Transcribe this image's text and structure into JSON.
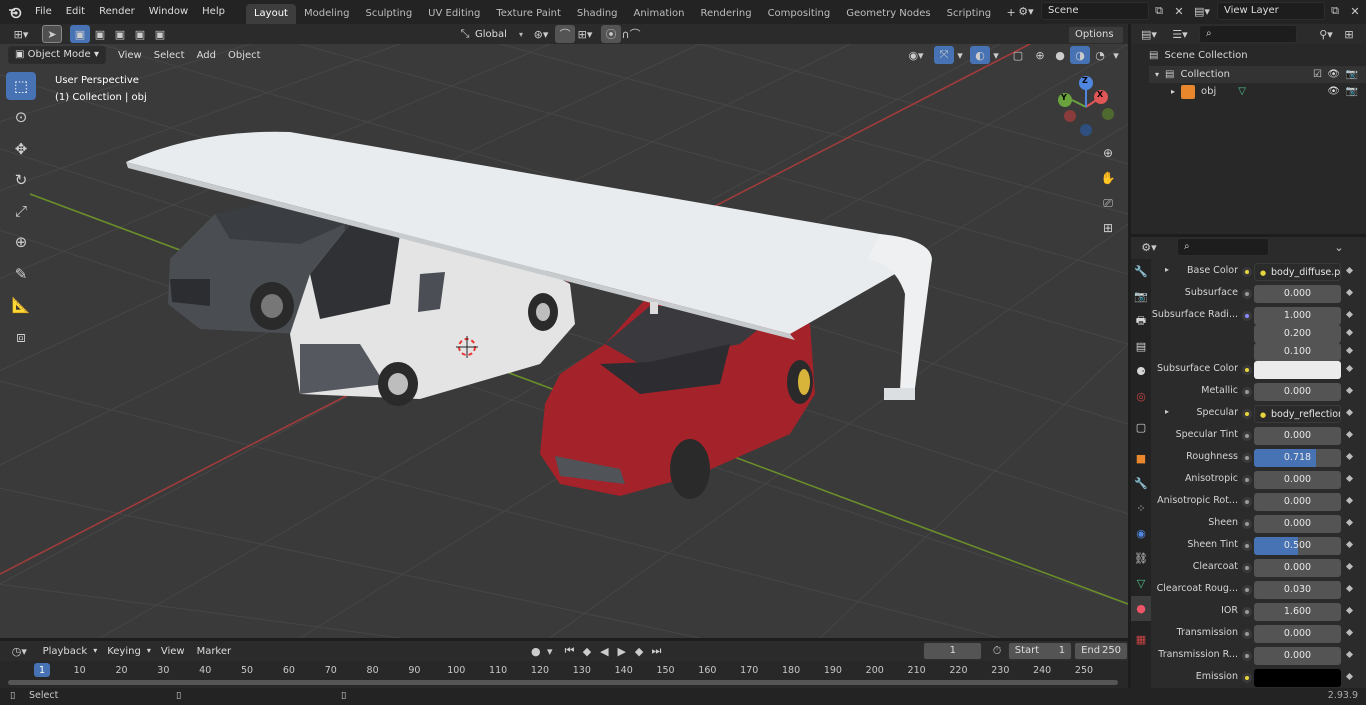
{
  "topbar": {
    "menus": [
      "File",
      "Edit",
      "Render",
      "Window",
      "Help"
    ],
    "workspaces": [
      "Layout",
      "Modeling",
      "Sculpting",
      "UV Editing",
      "Texture Paint",
      "Shading",
      "Animation",
      "Rendering",
      "Compositing",
      "Geometry Nodes",
      "Scripting"
    ],
    "active_workspace": "Layout",
    "scene": "Scene",
    "view_layer": "View Layer"
  },
  "viewport_header": {
    "mode": "Object Mode",
    "menus": [
      "View",
      "Select",
      "Add",
      "Object"
    ],
    "transform_orientation": "Global",
    "options": "Options"
  },
  "viewport": {
    "perspective": "User Perspective",
    "collection_info": "(1) Collection | obj",
    "axes": {
      "x": "X",
      "y": "Y",
      "z": "Z"
    }
  },
  "outliner": {
    "root": "Scene Collection",
    "collection": "Collection",
    "object": "obj"
  },
  "properties": {
    "rows": [
      {
        "label": "Base Color",
        "value": "body_diffuse.png",
        "kind": "texture",
        "expand": true
      },
      {
        "label": "Subsurface",
        "value": "0.000",
        "kind": "num"
      },
      {
        "label": "Subsurface Radi...",
        "value": "1.000",
        "kind": "num",
        "dot": "b"
      },
      {
        "label": "",
        "value": "0.200",
        "kind": "num",
        "nodot": true
      },
      {
        "label": "",
        "value": "0.100",
        "kind": "num",
        "nodot": true
      },
      {
        "label": "Subsurface Color",
        "value": "",
        "kind": "color",
        "color": "#ececec"
      },
      {
        "label": "Metallic",
        "value": "0.000",
        "kind": "num"
      },
      {
        "label": "Specular",
        "value": "body_reflection.png",
        "kind": "texture",
        "expand": true
      },
      {
        "label": "Specular Tint",
        "value": "0.000",
        "kind": "num"
      },
      {
        "label": "Roughness",
        "value": "0.718",
        "kind": "num",
        "fill": 0.718
      },
      {
        "label": "Anisotropic",
        "value": "0.000",
        "kind": "num"
      },
      {
        "label": "Anisotropic Rot...",
        "value": "0.000",
        "kind": "num"
      },
      {
        "label": "Sheen",
        "value": "0.000",
        "kind": "num"
      },
      {
        "label": "Sheen Tint",
        "value": "0.500",
        "kind": "num",
        "fill": 0.5
      },
      {
        "label": "Clearcoat",
        "value": "0.000",
        "kind": "num"
      },
      {
        "label": "Clearcoat Roug...",
        "value": "0.030",
        "kind": "num"
      },
      {
        "label": "IOR",
        "value": "1.600",
        "kind": "num"
      },
      {
        "label": "Transmission",
        "value": "0.000",
        "kind": "num"
      },
      {
        "label": "Transmission R...",
        "value": "0.000",
        "kind": "num"
      },
      {
        "label": "Emission",
        "value": "",
        "kind": "color",
        "color": "#000000"
      }
    ]
  },
  "timeline": {
    "menus": [
      "Playback",
      "Keying",
      "View",
      "Marker"
    ],
    "current_frame": "1",
    "start_label": "Start",
    "start": "1",
    "end_label": "End",
    "end": "250",
    "ticks": [
      "1",
      "10",
      "20",
      "30",
      "40",
      "50",
      "60",
      "70",
      "80",
      "90",
      "100",
      "110",
      "120",
      "130",
      "140",
      "150",
      "160",
      "170",
      "180",
      "190",
      "200",
      "210",
      "220",
      "230",
      "240",
      "250"
    ]
  },
  "status": {
    "left": "Select",
    "version": "2.93.9"
  }
}
